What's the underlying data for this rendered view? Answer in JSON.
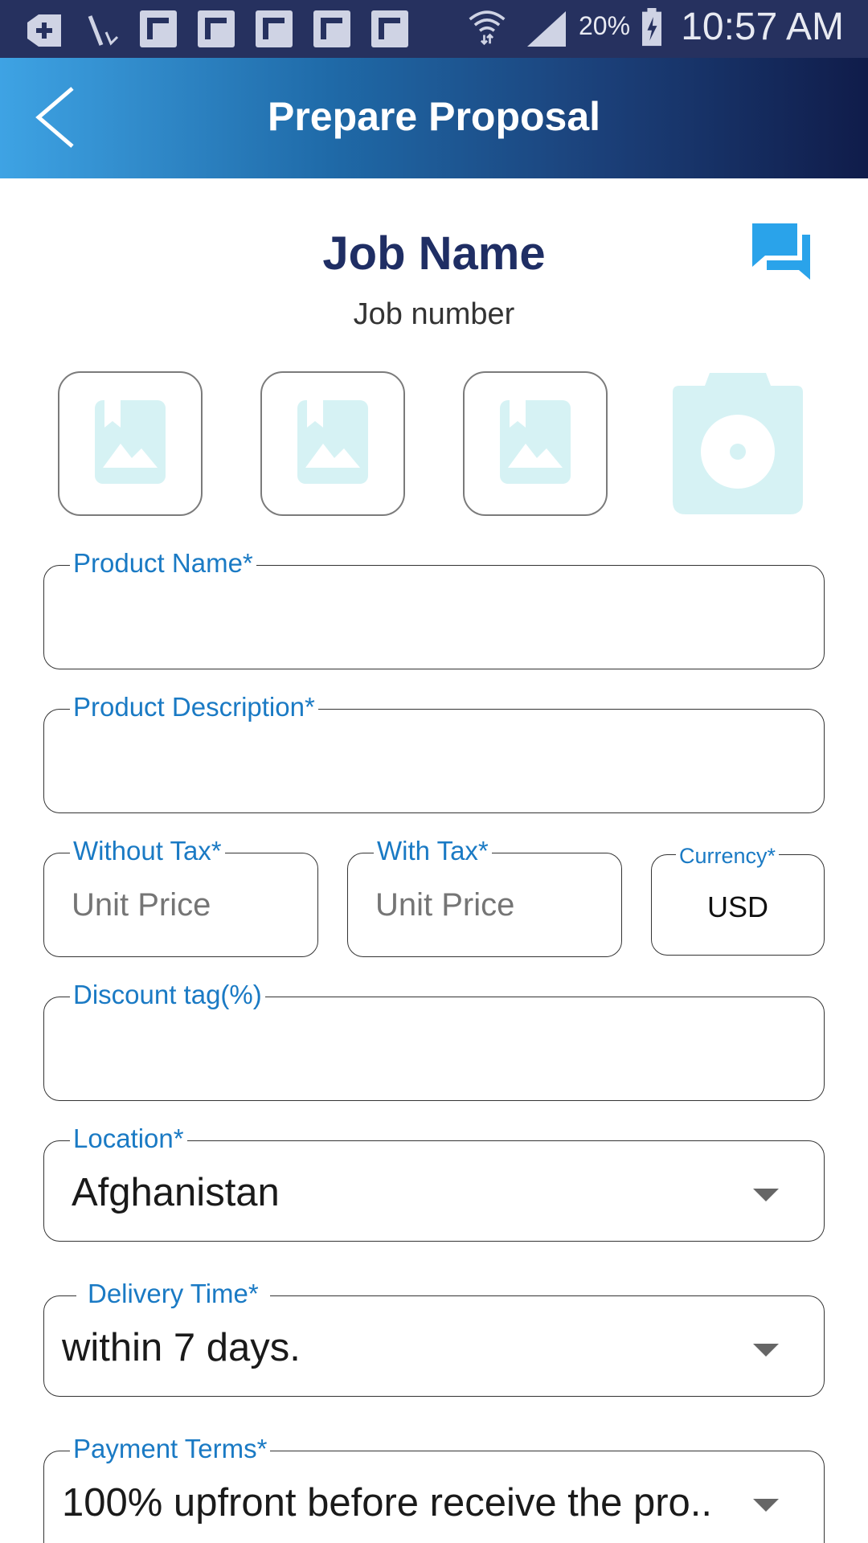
{
  "status_bar": {
    "battery": "20%",
    "time": "10:57 AM",
    "icons": [
      "download-icon",
      "missed-call-icon",
      "notification-icon",
      "notification-icon",
      "notification-icon",
      "notification-icon",
      "notification-icon",
      "wifi-icon",
      "signal-icon",
      "battery-charging-icon"
    ]
  },
  "header": {
    "title": "Prepare Proposal",
    "back_icon": "chevron-left-icon"
  },
  "job": {
    "name": "Job Name",
    "number": "Job number",
    "chat_icon": "chat-icon"
  },
  "images": {
    "slots": [
      "image-placeholder-icon",
      "image-placeholder-icon",
      "image-placeholder-icon"
    ],
    "camera_icon": "camera-icon"
  },
  "form": {
    "product_name": {
      "label": "Product Name*",
      "value": ""
    },
    "product_description": {
      "label": "Product Description*",
      "value": ""
    },
    "without_tax": {
      "label": "Without Tax*",
      "placeholder": "Unit Price"
    },
    "with_tax": {
      "label": "With Tax*",
      "placeholder": "Unit Price"
    },
    "currency": {
      "label": "Currency*",
      "value": "USD"
    },
    "discount": {
      "label": "Discount tag(%)",
      "value": ""
    },
    "location": {
      "label": "Location*",
      "value": "Afghanistan"
    },
    "delivery_time": {
      "label": "Delivery Time*",
      "value": "within 7 days."
    },
    "payment_terms": {
      "label": "Payment Terms*",
      "value": "100% upfront before receive the pro.."
    }
  },
  "colors": {
    "status_bar": "#26315f",
    "header_gradient_start": "#3ea3e4",
    "header_gradient_end": "#101c4a",
    "title_navy": "#1f2e64",
    "label_blue": "#1a7ac4",
    "placeholder_icon": "#d6f2f4"
  }
}
